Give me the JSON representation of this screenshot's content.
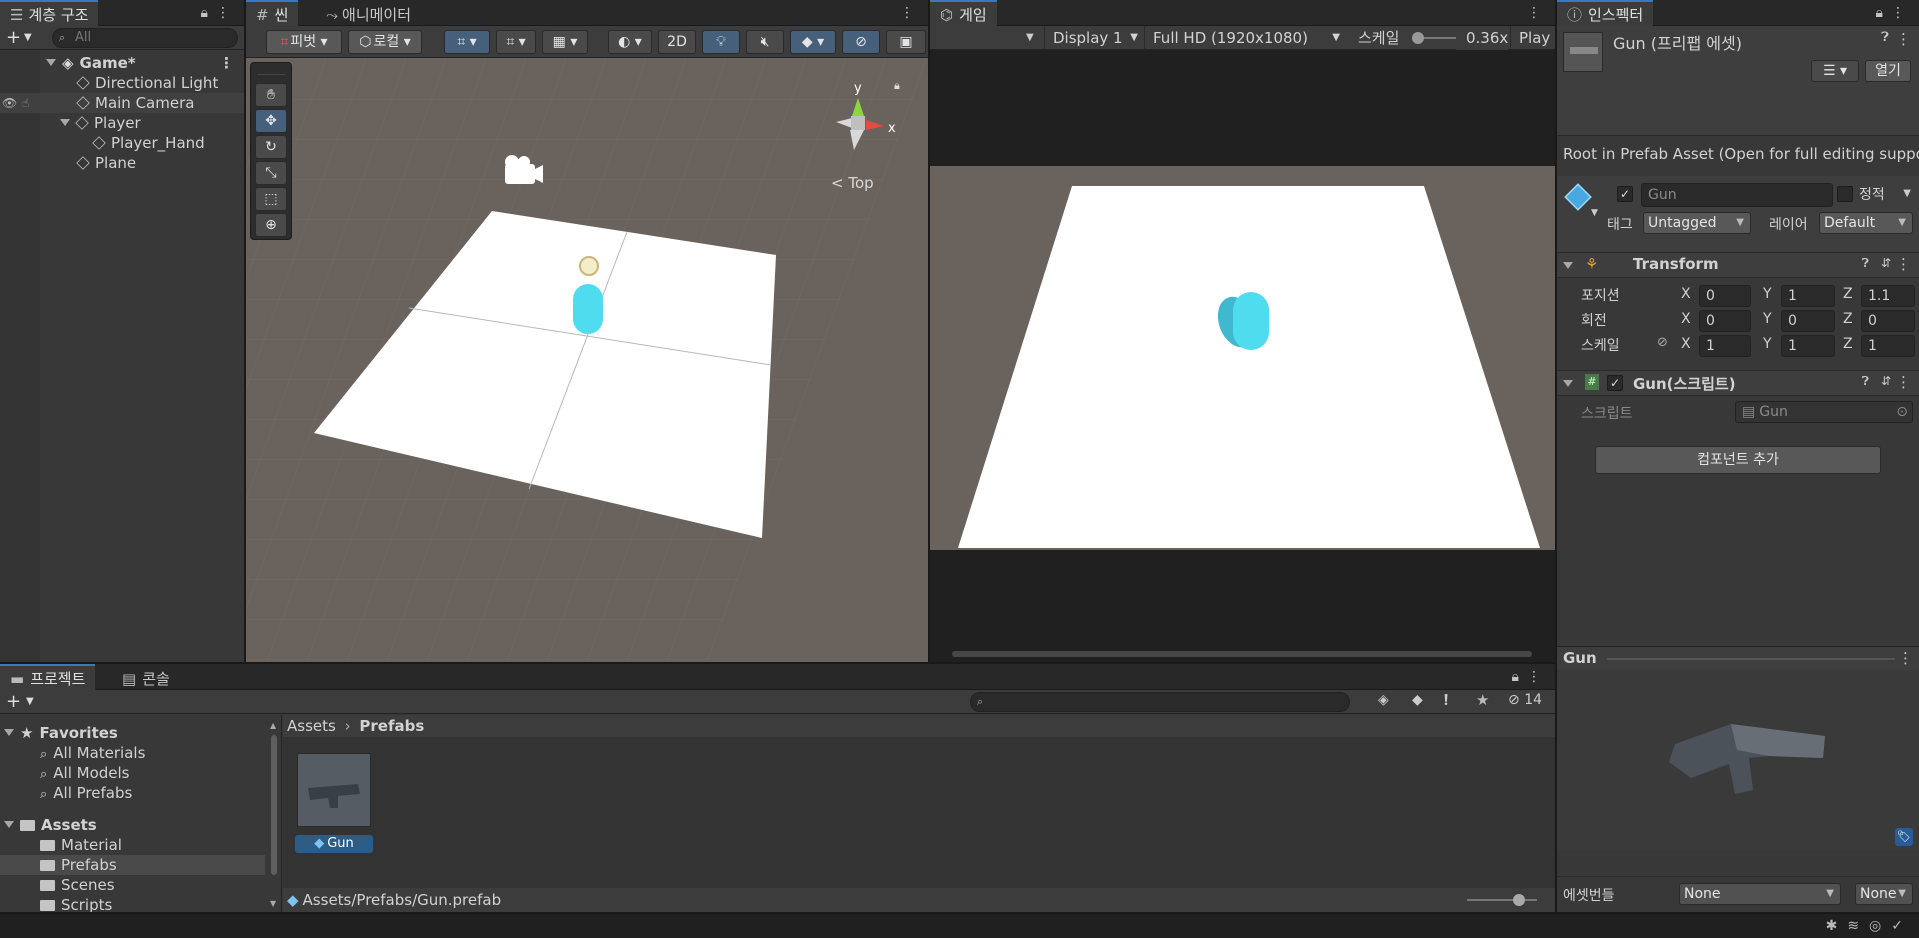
{
  "hierarchy": {
    "tab_label": "계층 구조",
    "search_placeholder": "All",
    "scene_name": "Game*",
    "items": [
      {
        "label": "Directional Light"
      },
      {
        "label": "Main Camera"
      },
      {
        "label": "Player"
      },
      {
        "label": "Player_Hand"
      },
      {
        "label": "Plane"
      }
    ]
  },
  "scene": {
    "tab_label": "씬",
    "animator_tab_label": "애니메이터",
    "pivot_label": "피벗",
    "local_label": "로컬",
    "mode_2d_label": "2D",
    "gizmo_view_label": "Top",
    "gizmo_y": "y",
    "gizmo_x": "x"
  },
  "game": {
    "tab_label": "게임",
    "display_label": "Display 1",
    "resolution_label": "Full HD (1920x1080)",
    "scale_label": "스케일",
    "scale_value": "0.36x",
    "play_label": "Play F"
  },
  "inspector": {
    "tab_label": "인스펙터",
    "title": "Gun (프리팹 에셋)",
    "open_button": "열기",
    "prefab_notice": "Root in Prefab Asset (Open for full editing suppo",
    "object_name": "Gun",
    "static_label": "정적",
    "tag_label": "태그",
    "tag_value": "Untagged",
    "layer_label": "레이어",
    "layer_value": "Default",
    "transform": {
      "title": "Transform",
      "position_label": "포지션",
      "rotation_label": "회전",
      "scale_label": "스케일",
      "position": {
        "x": "0",
        "y": "1",
        "z": "1.1"
      },
      "rotation": {
        "x": "0",
        "y": "0",
        "z": "0"
      },
      "scale": {
        "x": "1",
        "y": "1",
        "z": "1"
      },
      "axis_x": "X",
      "axis_y": "Y",
      "axis_z": "Z"
    },
    "script_component": {
      "title": "Gun(스크립트)",
      "script_label": "스크립트",
      "script_value": "Gun"
    },
    "add_component_button": "컴포넌트 추가",
    "preview_title": "Gun",
    "asset_bundle_label": "에셋번들",
    "asset_bundle_value": "None",
    "asset_bundle_variant": "None"
  },
  "project": {
    "tab_label": "프로젝트",
    "console_tab_label": "콘솔",
    "hidden_count": "14",
    "favorites_label": "Favorites",
    "favorites": [
      {
        "label": "All Materials"
      },
      {
        "label": "All Models"
      },
      {
        "label": "All Prefabs"
      }
    ],
    "assets_label": "Assets",
    "folders": [
      {
        "label": "Material"
      },
      {
        "label": "Prefabs"
      },
      {
        "label": "Scenes"
      },
      {
        "label": "Scripts"
      }
    ],
    "breadcrumb_root": "Assets",
    "breadcrumb_current": "Prefabs",
    "asset_name": "Gun",
    "path": "Assets/Prefabs/Gun.prefab"
  },
  "colors": {
    "accent": "#3a79bb",
    "selection": "#2c5d87",
    "panel": "#383838",
    "scene_ground": "#6a625d",
    "capsule": "#4fdcef"
  }
}
